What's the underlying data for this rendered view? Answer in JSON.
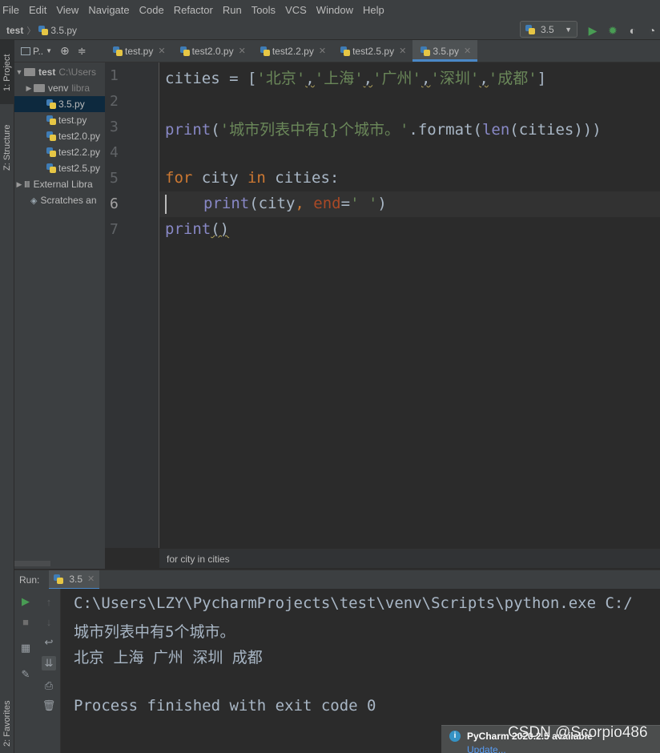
{
  "menu": [
    "File",
    "Edit",
    "View",
    "Navigate",
    "Code",
    "Refactor",
    "Run",
    "Tools",
    "VCS",
    "Window",
    "Help"
  ],
  "navbar": {
    "project": "test",
    "file": "3.5.py",
    "run_config": "3.5"
  },
  "stripe": {
    "project": "1: Project",
    "structure": "Z: Structure",
    "favorites": "2: Favorites"
  },
  "project": {
    "view_label": "P..",
    "root": {
      "name": "test",
      "path": "C:\\Users"
    },
    "venv": {
      "name": "venv",
      "note": "libra"
    },
    "files": [
      "3.5.py",
      "test.py",
      "test2.0.py",
      "test2.2.py",
      "test2.5.py"
    ],
    "selected_file": "3.5.py",
    "external": "External Libra",
    "scratches": "Scratches an"
  },
  "tabs": [
    {
      "label": "test.py",
      "active": false
    },
    {
      "label": "test2.0.py",
      "active": false
    },
    {
      "label": "test2.2.py",
      "active": false
    },
    {
      "label": "test2.5.py",
      "active": false
    },
    {
      "label": "3.5.py",
      "active": true
    }
  ],
  "editor": {
    "line_numbers": [
      "1",
      "2",
      "3",
      "4",
      "5",
      "6",
      "7"
    ],
    "current_line": "6",
    "code": {
      "l1_var": "cities",
      "l1_assign": " = [",
      "l1_s1": "'北京'",
      "l1_s2": "'上海'",
      "l1_s3": "'广州'",
      "l1_s4": "'深圳'",
      "l1_s5": "'成都'",
      "l1_close": "]",
      "l3_print": "print",
      "l3_open": "(",
      "l3_str": "'城市列表中有{}个城市。'",
      "l3_format": ".format(",
      "l3_len": "len",
      "l3_rest": "(cities)))",
      "l5_for": "for",
      "l5_city": " city ",
      "l5_in": "in",
      "l5_rest": " cities:",
      "l6_print": "print",
      "l6_open": "(city",
      "l6_comma": ", ",
      "l6_end": "end",
      "l6_eq": "=",
      "l6_str": "' '",
      "l6_close": ")",
      "l7_print": "print",
      "l7_parens": "()"
    },
    "breadcrumb": "for city in cities"
  },
  "run": {
    "label": "Run:",
    "tab": "3.5",
    "output": [
      "C:\\Users\\LZY\\PycharmProjects\\test\\venv\\Scripts\\python.exe C:/",
      "城市列表中有5个城市。",
      "北京 上海 广州 深圳 成都",
      "",
      "Process finished with exit code 0"
    ]
  },
  "notification": {
    "title": "PyCharm 2020.2.5 available",
    "link": "Update..."
  },
  "watermark": "CSDN @Scorpio486",
  "colors": {
    "keyword": "#cc7832",
    "string": "#6a8759",
    "builtin": "#8888c6",
    "param": "#aa4926",
    "text": "#a9b7c6",
    "accent": "#4a88c7"
  }
}
